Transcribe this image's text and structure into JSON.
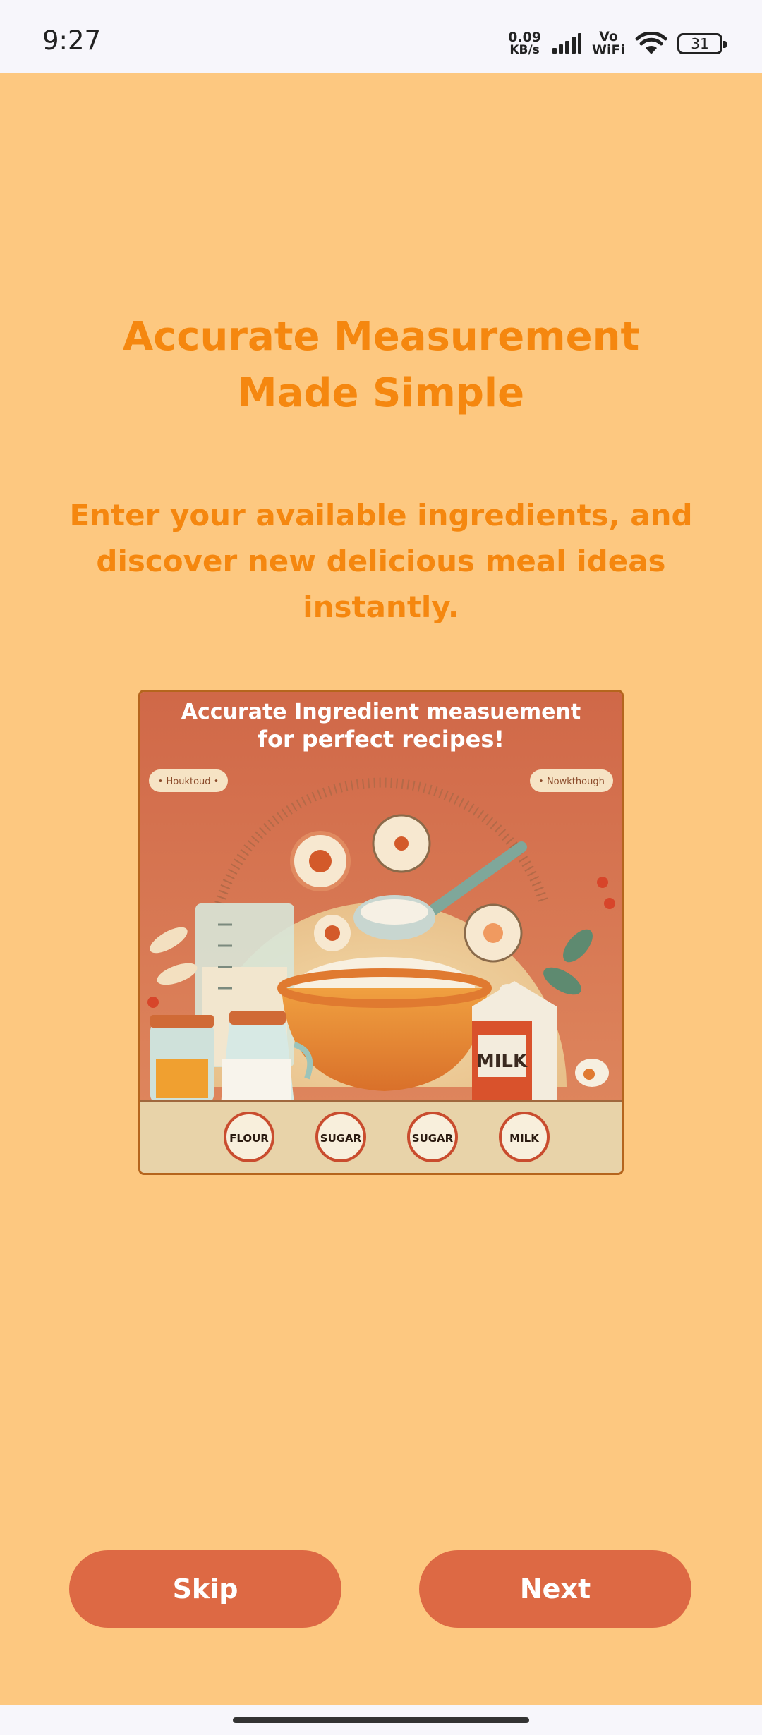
{
  "status_bar": {
    "time": "9:27",
    "net_speed_value": "0.09",
    "net_speed_unit": "KB/s",
    "vowifi_top": "Vo",
    "vowifi_bottom": "WiFi",
    "battery": "31",
    "icons": [
      "signal-icon",
      "wifi-icon",
      "battery-icon"
    ]
  },
  "onboarding": {
    "title": "Accurate Measurement Made Simple",
    "subtitle": "Enter your available ingredients, and discover new delicious meal ideas instantly."
  },
  "illustration": {
    "heading_line1": "Accurate Ingredient measuement",
    "heading_line2": "for perfect recipes!",
    "left_tag": "• Houktoud •",
    "right_tag": "• Nowkthough",
    "carton_label": "MILK",
    "badges": [
      "FLOUR",
      "SUGAR",
      "SUGAR",
      "MILK"
    ]
  },
  "buttons": {
    "skip_label": "Skip",
    "next_label": "Next"
  },
  "colors": {
    "background": "#FDC880",
    "accent_text": "#F5870F",
    "button": "#DD6944",
    "button_text": "#FFFFFF"
  }
}
